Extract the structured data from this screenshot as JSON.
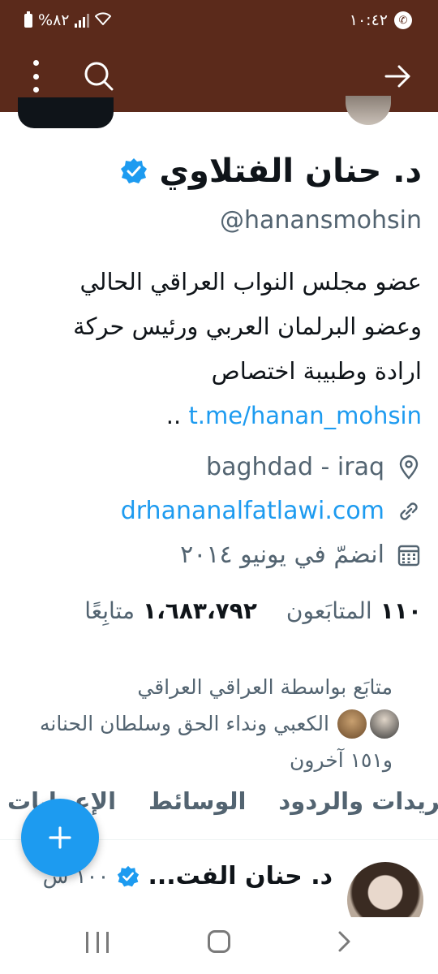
{
  "status_bar": {
    "battery": "%٨٢",
    "time": "١٠:٤٢"
  },
  "top_bar": {
    "icons": [
      "more-vertical-icon",
      "search-icon",
      "arrow-right-icon"
    ],
    "color": "#5b2a1b"
  },
  "profile": {
    "name": "د. حنان الفتلاوي",
    "handle": "@hanansmohsin",
    "bio_text_1": "عضو مجلس النواب العراقي الحالي وعضو البرلمان العربي ورئيس حركة ارادة وطبيبة اختصاص ",
    "bio_link": "t.me/hanan_mohsin",
    "bio_tail": " ..",
    "location": "baghdad - iraq",
    "website": "drhananalfatlawi.com",
    "joined": "انضمّ في يونيو ٢٠١٤",
    "following_count": "١١٠",
    "following_label": "المتابَعون",
    "followers_count": "١،٦٨٣،٧٩٢",
    "followers_label": "متابِعًا",
    "followed_by_1": "متابَع بواسطة العراقي العراقي",
    "followed_by_2": "الكعبي ونداء الحق وسلطان الحنانه",
    "followed_by_3": "و١٥١ آخرون"
  },
  "tabs": [
    {
      "label": "التغريدات والردود"
    },
    {
      "label": "الوسائط"
    },
    {
      "label": "الإعجابات"
    }
  ],
  "tweet": {
    "name": "د. حنان الفت...",
    "time": "١٠٠ ش",
    "text": "..."
  },
  "colors": {
    "accent": "#1d9bf0",
    "text": "#0f1419",
    "secondary": "#536471",
    "header": "#5b2a1b"
  }
}
